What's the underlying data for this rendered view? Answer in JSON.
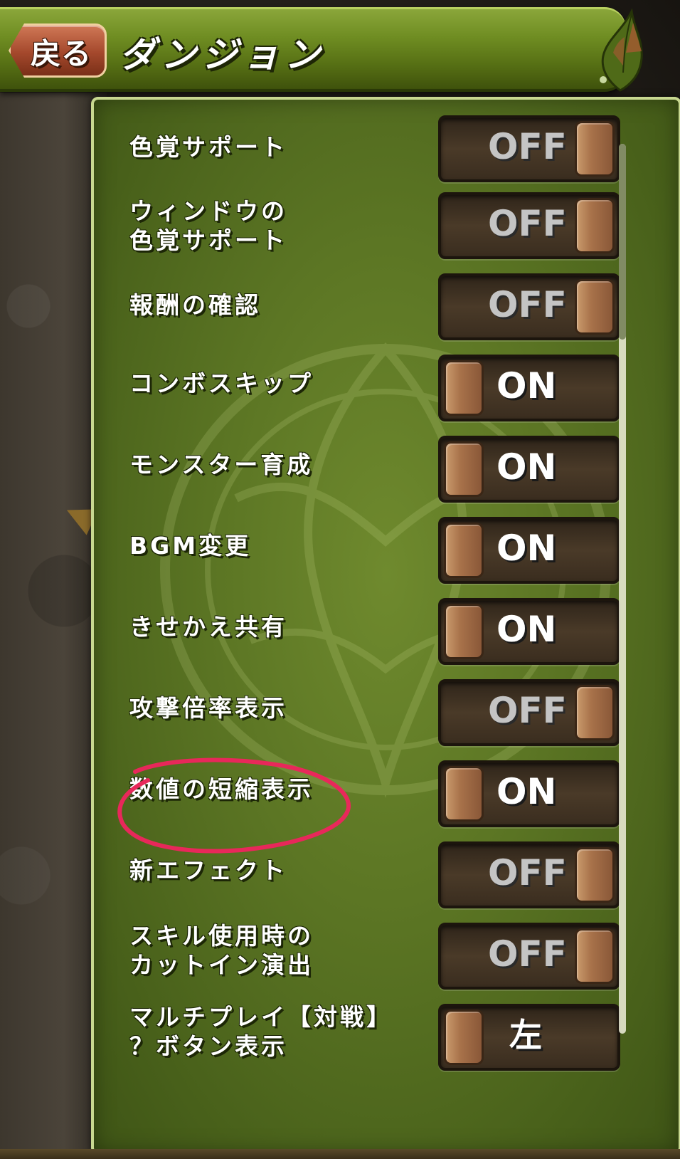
{
  "header": {
    "back_label": "戻る",
    "title": "ダンジョン"
  },
  "settings": [
    {
      "label": "色覚サポート",
      "value": "OFF",
      "state": "off"
    },
    {
      "label": "ウィンドウの\n色覚サポート",
      "value": "OFF",
      "state": "off"
    },
    {
      "label": "報酬の確認",
      "value": "OFF",
      "state": "off"
    },
    {
      "label": "コンボスキップ",
      "value": "ON",
      "state": "on"
    },
    {
      "label": "モンスター育成",
      "value": "ON",
      "state": "on"
    },
    {
      "label": "BGM変更",
      "value": "ON",
      "state": "on"
    },
    {
      "label": "きせかえ共有",
      "value": "ON",
      "state": "on"
    },
    {
      "label": "攻撃倍率表示",
      "value": "OFF",
      "state": "off"
    },
    {
      "label": "数値の短縮表示",
      "value": "ON",
      "state": "on"
    },
    {
      "label": "新エフェクト",
      "value": "OFF",
      "state": "off"
    },
    {
      "label": "スキル使用時の\nカットイン演出",
      "value": "OFF",
      "state": "off"
    },
    {
      "label": "マルチプレイ【対戦】\n？ボタン表示",
      "value": "左",
      "state": "side"
    }
  ],
  "colors": {
    "header_green": "#6f8d22",
    "panel_green": "#5c7624",
    "back_button": "#a4482c",
    "annotation_circle": "#e8285a"
  },
  "scroll_position": 0.0
}
